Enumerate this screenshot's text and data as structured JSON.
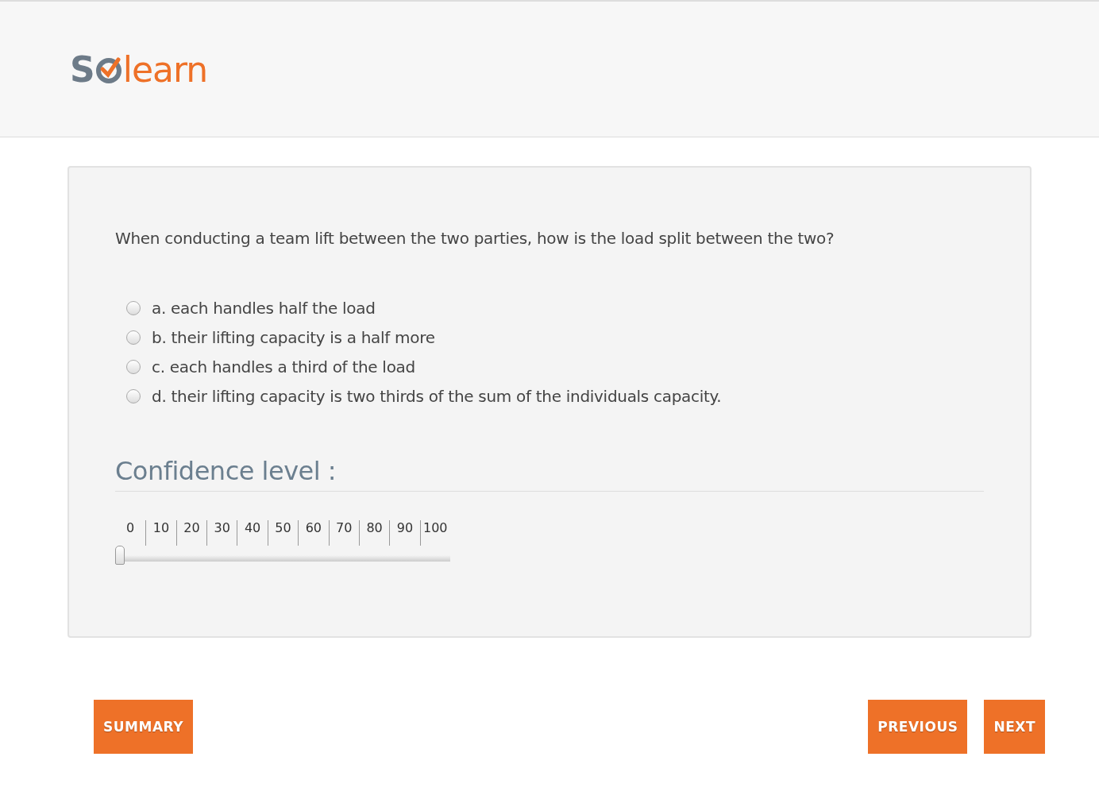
{
  "logo": {
    "prefix": "S",
    "suffix": "learn"
  },
  "question": "When conducting a team lift between the two parties, how is the load split between the two?",
  "options": [
    {
      "label": "a. each handles half the load",
      "selected": false
    },
    {
      "label": "b. their lifting capacity is a half more",
      "selected": false
    },
    {
      "label": "c. each handles a third of the load",
      "selected": false
    },
    {
      "label": "d. their lifting capacity is two thirds of the sum of the individuals capacity.",
      "selected": false
    }
  ],
  "confidence": {
    "heading": "Confidence level :",
    "ticks": [
      "0",
      "10",
      "20",
      "30",
      "40",
      "50",
      "60",
      "70",
      "80",
      "90",
      "100"
    ],
    "level": 0
  },
  "buttons": {
    "left": [
      "SUMMARY"
    ],
    "right": [
      "PREVIOUS",
      "NEXT"
    ]
  }
}
